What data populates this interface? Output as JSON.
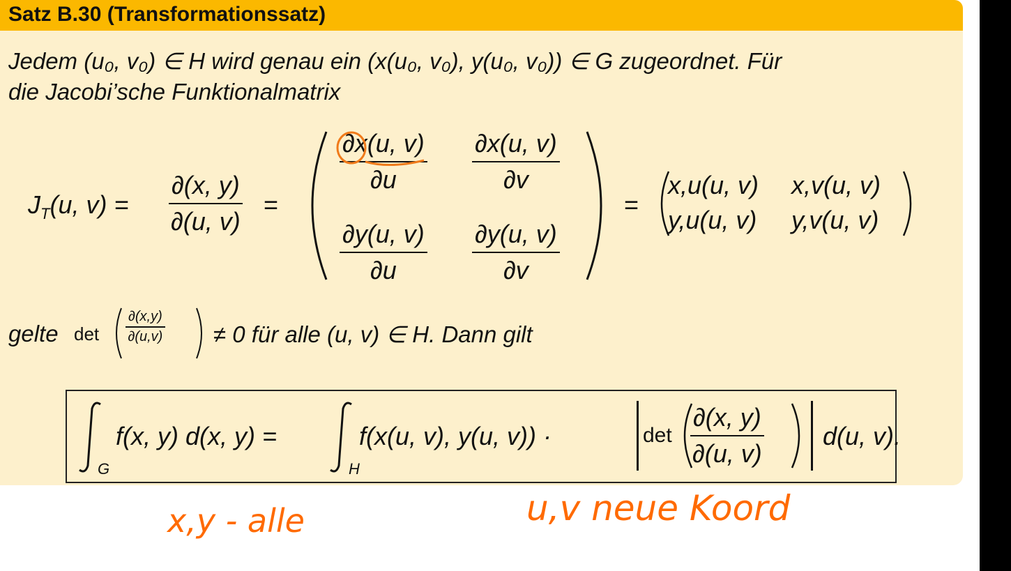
{
  "theorem": {
    "title": "Satz B.30 (Transformationssatz)",
    "line1": "Jedem (u₀, v₀) ∈ H wird genau ein (x(u₀, v₀), y(u₀, v₀)) ∈ G zugeordnet. Für",
    "line2": "die Jacobi’sche Funktionalmatrix",
    "jacobian_lhs": "J",
    "jacobian_lhs_sub": "T",
    "jacobian_lhs_args": "(u, v) =",
    "frac_num": "∂(x, y)",
    "frac_den": "∂(u, v)",
    "eq": "=",
    "m11_num": "∂x(u, v)",
    "m11_den": "∂u",
    "m12_num": "∂x(u, v)",
    "m12_den": "∂v",
    "m21_num": "∂y(u, v)",
    "m21_den": "∂u",
    "m22_num": "∂y(u, v)",
    "m22_den": "∂v",
    "eq2": "=",
    "r11": "x,u(u, v)",
    "r12": "x,v(u, v)",
    "r21": "y,u(u, v)",
    "r22": "y,v(u, v)",
    "gelte_prefix": "gelte",
    "det_label": "det",
    "small_num": "∂(x,y)",
    "small_den": "∂(u,v)",
    "gelte_suffix": "≠ 0 für alle (u, v) ∈ H. Dann gilt",
    "int_left": "f(x, y) d(x, y) =",
    "int_left_sub": "G",
    "int_right": "f(x(u, v), y(u, v)) ·",
    "int_right_sub": "H",
    "int_det": "det",
    "int_frac_num": "∂(x, y)",
    "int_frac_den": "∂(u, v)",
    "int_end": "d(u, v)."
  },
  "handwriting": {
    "left_note": "x,y - alle",
    "right_note": "u,v neue Koord"
  }
}
